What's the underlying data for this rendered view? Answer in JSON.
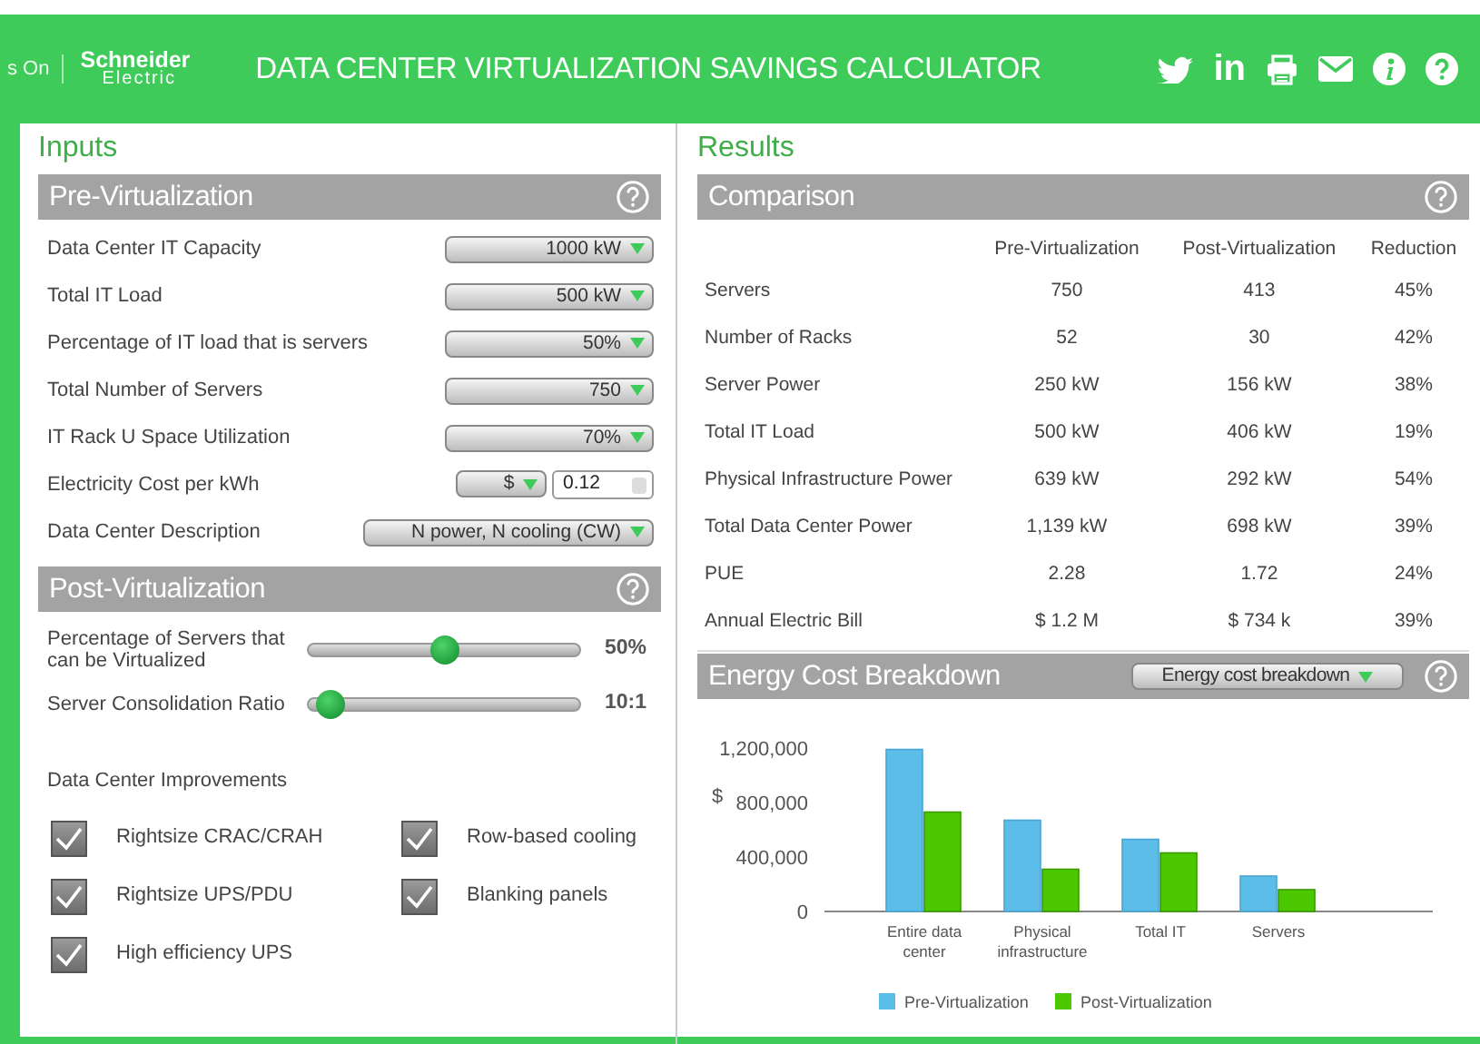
{
  "header": {
    "brand_fragment": "s On",
    "logo_line1": "Schneider",
    "logo_line2": "Electric",
    "title": "DATA CENTER VIRTUALIZATION SAVINGS CALCULATOR",
    "linkedin": "in"
  },
  "inputs": {
    "title": "Inputs",
    "pre": {
      "title": "Pre-Virtualization",
      "fields": [
        {
          "label": "Data Center IT Capacity",
          "kind": "select",
          "value": "1000 kW"
        },
        {
          "label": "Total IT Load",
          "kind": "select",
          "value": "500 kW"
        },
        {
          "label": "Percentage of IT load that is servers",
          "kind": "select",
          "value": "50%"
        },
        {
          "label": "Total Number of Servers",
          "kind": "select",
          "value": "750"
        },
        {
          "label": "IT Rack U Space Utilization",
          "kind": "select",
          "value": "70%"
        },
        {
          "label": "Electricity Cost per kWh",
          "kind": "currency",
          "currency": "$",
          "value": "0.12"
        },
        {
          "label": "Data Center Description",
          "kind": "wide-select",
          "value": "N power, N cooling (CW)"
        }
      ]
    },
    "post": {
      "title": "Post-Virtualization",
      "sliders": [
        {
          "label": "Percentage of Servers that can be Virtualized",
          "level": 0.5,
          "reading": "50%"
        },
        {
          "label": "Server Consolidation Ratio",
          "level": 0.04,
          "reading": "10:1"
        }
      ],
      "improvements_label": "Data Center Improvements",
      "checkboxes": [
        {
          "label": "Rightsize CRAC/CRAH",
          "checked": true
        },
        {
          "label": "Row-based cooling",
          "checked": true
        },
        {
          "label": "Rightsize UPS/PDU",
          "checked": true
        },
        {
          "label": "Blanking panels",
          "checked": true
        },
        {
          "label": "High efficiency UPS",
          "checked": true
        }
      ]
    }
  },
  "results": {
    "title": "Results",
    "comparison": {
      "title": "Comparison",
      "columns": [
        "Pre-Virtualization",
        "Post-Virtualization",
        "Reduction"
      ],
      "rows": [
        {
          "label": "Servers",
          "pre": "750",
          "post": "413",
          "reduction": "45%"
        },
        {
          "label": "Number of Racks",
          "pre": "52",
          "post": "30",
          "reduction": "42%"
        },
        {
          "label": "Server Power",
          "pre": "250 kW",
          "post": "156 kW",
          "reduction": "38%"
        },
        {
          "label": "Total IT Load",
          "pre": "500 kW",
          "post": "406 kW",
          "reduction": "19%"
        },
        {
          "label": "Physical Infrastructure Power",
          "pre": "639 kW",
          "post": "292 kW",
          "reduction": "54%"
        },
        {
          "label": "Total Data Center Power",
          "pre": "1,139 kW",
          "post": "698 kW",
          "reduction": "39%"
        },
        {
          "label": "PUE",
          "pre": "2.28",
          "post": "1.72",
          "reduction": "24%"
        },
        {
          "label": "Annual Electric Bill",
          "pre": "$ 1.2 M",
          "post": "$ 734 k",
          "reduction": "39%"
        }
      ]
    },
    "energy": {
      "title": "Energy Cost Breakdown",
      "dropdown": "Energy cost breakdown",
      "chart_data": {
        "type": "bar",
        "ylabel": "$",
        "categories": [
          "Entire data center",
          "Physical infrastructure",
          "Total IT",
          "Servers"
        ],
        "series": [
          {
            "name": "Pre-Virtualization",
            "color": "#5bbde8",
            "values": [
              1190000,
              670000,
              530000,
              260000
            ]
          },
          {
            "name": "Post-Virtualization",
            "color": "#4cc800",
            "values": [
              730000,
              310000,
              430000,
              160000
            ]
          }
        ],
        "legend": "bottom",
        "ylim": [
          0,
          1200000
        ],
        "yticks": [
          {
            "value": 0,
            "label": "0"
          },
          {
            "value": 400000,
            "label": "400,000"
          },
          {
            "value": 800000,
            "label": "800,000"
          },
          {
            "value": 1200000,
            "label": "1,200,000"
          }
        ]
      }
    }
  }
}
